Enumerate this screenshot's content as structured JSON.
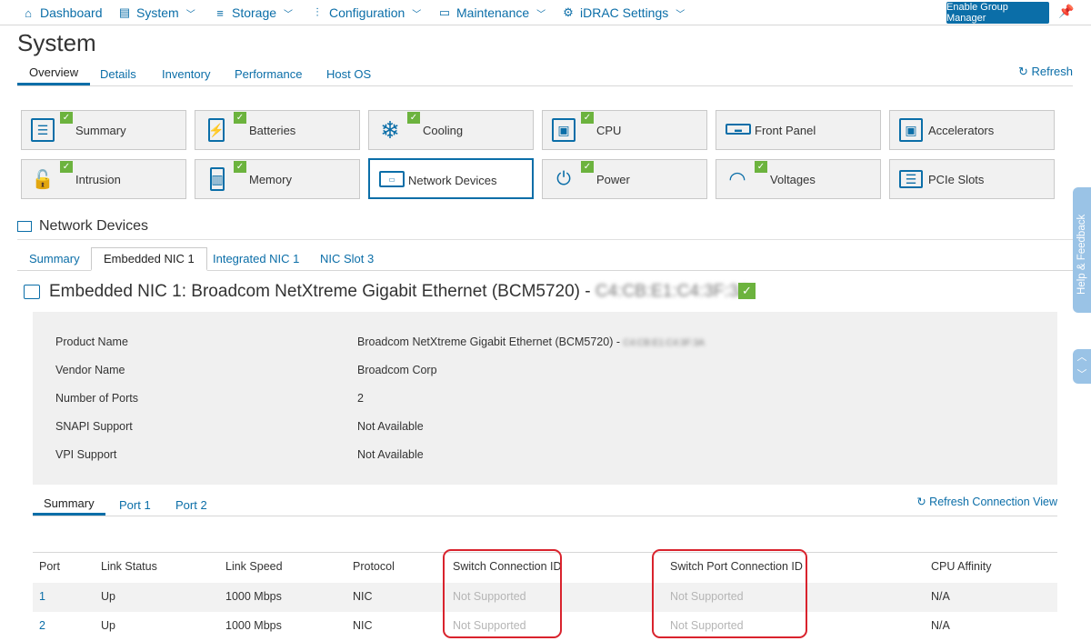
{
  "nav": {
    "items": [
      {
        "label": "Dashboard",
        "icon": "home-icon",
        "glyph": "⌂",
        "chevron": false
      },
      {
        "label": "System",
        "icon": "server-icon",
        "glyph": "▤",
        "chevron": true
      },
      {
        "label": "Storage",
        "icon": "database-icon",
        "glyph": "≡",
        "chevron": true
      },
      {
        "label": "Configuration",
        "icon": "sliders-icon",
        "glyph": "⫶",
        "chevron": true
      },
      {
        "label": "Maintenance",
        "icon": "monitor-icon",
        "glyph": "▭",
        "chevron": true
      },
      {
        "label": "iDRAC Settings",
        "icon": "gear-icon",
        "glyph": "⚙",
        "chevron": true
      }
    ],
    "group_manager": "Enable Group Manager"
  },
  "page": {
    "title": "System"
  },
  "main_tabs": [
    "Overview",
    "Details",
    "Inventory",
    "Performance",
    "Host OS"
  ],
  "refresh_label": "Refresh",
  "tiles": [
    {
      "label": "Summary",
      "icon": "summary-icon",
      "glyph": "☰",
      "ok": true
    },
    {
      "label": "Batteries",
      "icon": "battery-icon",
      "glyph": "⚡",
      "ok": true
    },
    {
      "label": "Cooling",
      "icon": "snowflake-icon",
      "glyph": "❄",
      "ok": true
    },
    {
      "label": "CPU",
      "icon": "cpu-icon",
      "glyph": "▣",
      "ok": true
    },
    {
      "label": "Front Panel",
      "icon": "front-panel-icon",
      "glyph": "▬",
      "ok": false
    },
    {
      "label": "Accelerators",
      "icon": "accelerator-icon",
      "glyph": "▣",
      "ok": false
    },
    {
      "label": "Intrusion",
      "icon": "lock-icon",
      "glyph": "🔓",
      "ok": true
    },
    {
      "label": "Memory",
      "icon": "memory-icon",
      "glyph": "▥",
      "ok": true
    },
    {
      "label": "Network Devices",
      "icon": "network-card-icon",
      "glyph": "▭",
      "ok": false,
      "active": true
    },
    {
      "label": "Power",
      "icon": "plug-icon",
      "glyph": "⏻",
      "ok": true
    },
    {
      "label": "Voltages",
      "icon": "gauge-icon",
      "glyph": "◠",
      "ok": true
    },
    {
      "label": "PCIe Slots",
      "icon": "pcie-slots-icon",
      "glyph": "☰",
      "ok": false
    }
  ],
  "section": {
    "title": "Network Devices"
  },
  "sub_tabs": [
    "Summary",
    "Embedded NIC 1",
    "Integrated NIC 1",
    "NIC Slot 3"
  ],
  "nic": {
    "title": "Embedded NIC 1: Broadcom NetXtreme Gigabit Ethernet (BCM5720) - ",
    "mac_blurred": "C4:CB:E1:C4:3F:3A"
  },
  "properties": [
    {
      "label": "Product Name",
      "value": "Broadcom NetXtreme Gigabit Ethernet (BCM5720) - ",
      "blur": "C4:CB:E1:C4:3F:3A"
    },
    {
      "label": "Vendor Name",
      "value": "Broadcom Corp"
    },
    {
      "label": "Number of Ports",
      "value": "2"
    },
    {
      "label": "SNAPI Support",
      "value": "Not Available"
    },
    {
      "label": "VPI Support",
      "value": "Not Available"
    }
  ],
  "port_tabs": [
    "Summary",
    "Port 1",
    "Port 2"
  ],
  "refresh_connection": "Refresh Connection View",
  "table": {
    "headers": [
      "Port",
      "Link Status",
      "Link Speed",
      "Protocol",
      "Switch Connection ID",
      "Switch Port Connection ID",
      "CPU Affinity"
    ],
    "rows": [
      [
        "1",
        "Up",
        "1000 Mbps",
        "NIC",
        "Not Supported",
        "Not Supported",
        "N/A"
      ],
      [
        "2",
        "Up",
        "1000 Mbps",
        "NIC",
        "Not Supported",
        "Not Supported",
        "N/A"
      ]
    ]
  },
  "feedback_label": "Help & Feedback",
  "colors": {
    "accent": "#0b6ea8",
    "ok": "#6cb33e",
    "highlight": "#d9232d"
  }
}
